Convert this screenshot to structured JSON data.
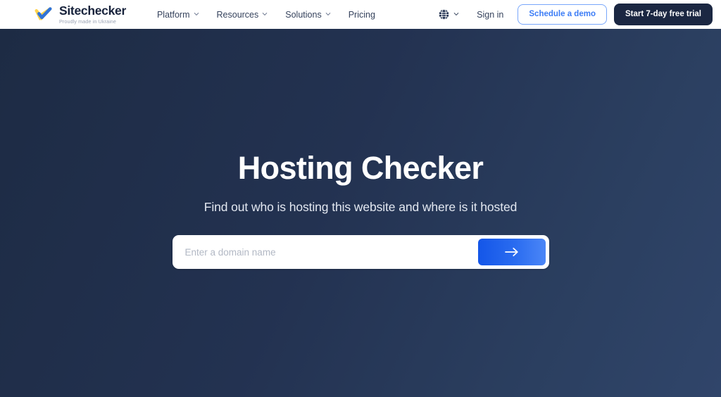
{
  "header": {
    "brand": {
      "name": "Sitechecker",
      "tagline": "Proudly made in Ukraine",
      "mark_icon": "ukraine-checkmark-icon"
    },
    "nav_items": [
      {
        "label": "Platform",
        "has_dropdown": true
      },
      {
        "label": "Resources",
        "has_dropdown": true
      },
      {
        "label": "Solutions",
        "has_dropdown": true
      },
      {
        "label": "Pricing",
        "has_dropdown": false
      }
    ],
    "language_selector": {
      "icon": "globe-icon",
      "chevron": "chevron-down-icon"
    },
    "sign_in_label": "Sign in",
    "demo_button_label": "Schedule a demo",
    "trial_button_label": "Start 7-day free trial"
  },
  "hero": {
    "title": "Hosting Checker",
    "subtitle": "Find out who is hosting this website and where is it hosted",
    "search": {
      "placeholder": "Enter a domain name",
      "value": "",
      "submit_icon": "arrow-right-icon"
    }
  },
  "colors": {
    "hero_bg_dark": "#1d2b44",
    "hero_bg_light": "#30456a",
    "accent_blue": "#3b7cf6",
    "button_gradient_start": "#1456e8",
    "button_gradient_end": "#4b86f7",
    "dark_navy": "#1b2742",
    "flag_blue": "#2f73d8",
    "flag_yellow": "#ffd24c"
  }
}
